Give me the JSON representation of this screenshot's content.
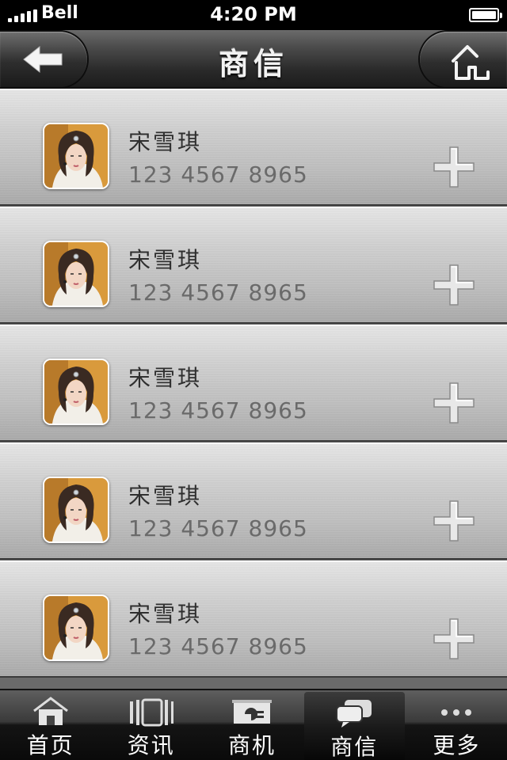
{
  "status_bar": {
    "carrier": "Bell",
    "time": "4:20 PM",
    "signal_bars": 5,
    "battery_level": 1.0
  },
  "nav": {
    "title": "商信",
    "back_icon": "back-arrow-icon",
    "home_icon": "home-icon"
  },
  "contacts": [
    {
      "name": "宋雪琪",
      "phone": "123 4567 8965",
      "action_icon": "plus-icon"
    },
    {
      "name": "宋雪琪",
      "phone": "123 4567 8965",
      "action_icon": "plus-icon"
    },
    {
      "name": "宋雪琪",
      "phone": "123 4567 8965",
      "action_icon": "plus-icon"
    },
    {
      "name": "宋雪琪",
      "phone": "123 4567 8965",
      "action_icon": "plus-icon"
    },
    {
      "name": "宋雪琪",
      "phone": "123 4567 8965",
      "action_icon": "plus-icon"
    }
  ],
  "tabs": [
    {
      "label": "首页",
      "icon": "home-icon",
      "active": false
    },
    {
      "label": "资讯",
      "icon": "news-icon",
      "active": false
    },
    {
      "label": "商机",
      "icon": "opportunity-icon",
      "active": false
    },
    {
      "label": "商信",
      "icon": "chat-icon",
      "active": true
    },
    {
      "label": "更多",
      "icon": "more-icon",
      "active": false
    }
  ],
  "colors": {
    "nav_bg": "#2a2a2a",
    "row_metal": "#c8c8c8",
    "tab_bg": "#1a1a1a",
    "name_text": "#2f2f2f",
    "phone_text": "#6a6a6a"
  }
}
